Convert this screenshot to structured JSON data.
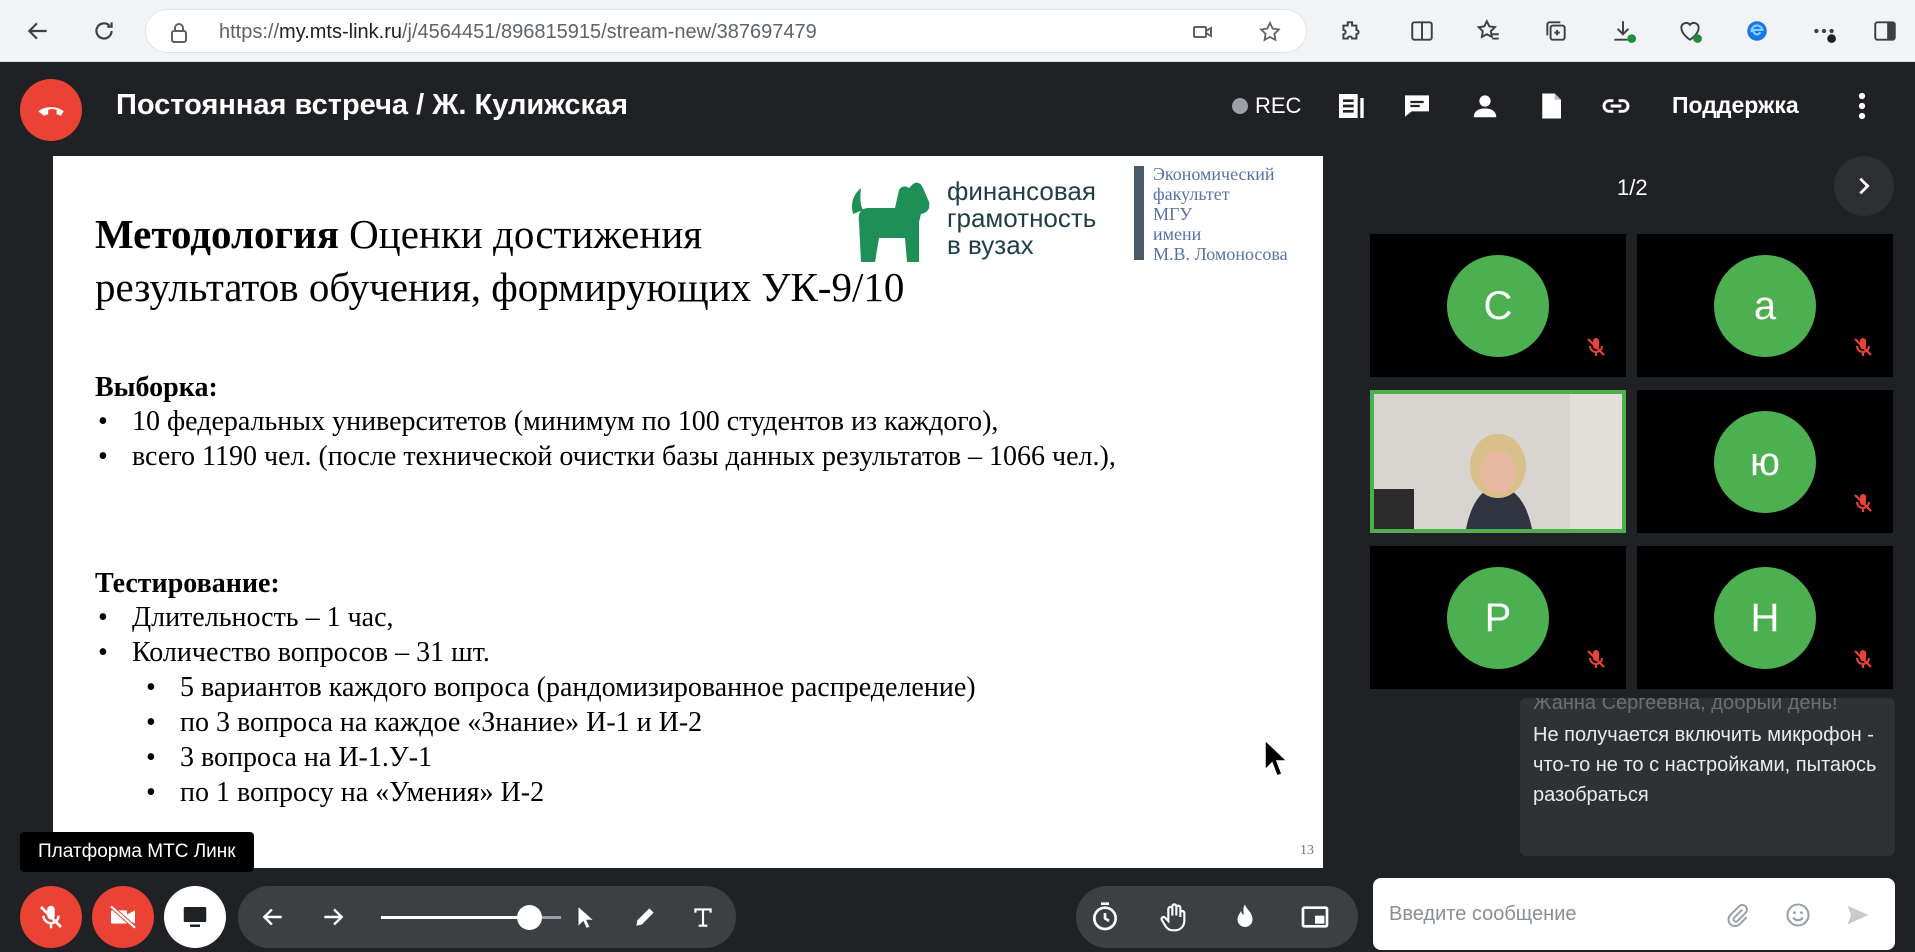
{
  "browser": {
    "url_prefix": "https://",
    "url_host": "my.mts-link.ru",
    "url_path": "/j/4564451/896815915/stream-new/387697479"
  },
  "meeting": {
    "title": "Постоянная встреча / Ж. Кулижская",
    "rec_label": "REC",
    "support_label": "Поддержка"
  },
  "slide": {
    "title_bold": "Методология",
    "title_rest": " Оценки достижения результатов обучения, формирующих УК-9/10",
    "logo_text": [
      "финансовая",
      "грамотность",
      "в вузах"
    ],
    "logo_msu": [
      "Экономический",
      "факультет",
      "МГУ",
      "имени",
      "М.В. Ломоносова"
    ],
    "section1_heading": "Выборка:",
    "section1_items": [
      "10 федеральных университетов (минимум по 100 студентов из каждого),",
      "всего 1190 чел. (после технической очистки базы данных результатов – 1066 чел.),"
    ],
    "section2_heading": "Тестирование:",
    "section2_items": [
      "Длительность – 1 час,",
      "Количество вопросов – 31 шт."
    ],
    "section2_subitems": [
      "5 вариантов каждого вопроса (рандомизированное распределение)",
      "по 3 вопроса на каждое «Знание» И-1 и И-2",
      "3 вопроса на И-1.У-1",
      "по 1 вопросу на «Умения» И-2"
    ],
    "page_number": "13",
    "bullet_char": "•"
  },
  "participants": {
    "pager": "1/2",
    "tiles": [
      {
        "initial": "С"
      },
      {
        "initial": "а"
      },
      {
        "initial": ""
      },
      {
        "initial": "ю"
      },
      {
        "initial": "Р"
      },
      {
        "initial": "Н"
      }
    ]
  },
  "chat": {
    "faded_text": "Жанна Сергеевна, добрый день!",
    "message": "Не получается включить микрофон - что-то не то с настройками, пытаюсь разобраться",
    "input_placeholder": "Введите сообщение"
  },
  "toolbar": {
    "tooltip": "Платформа МТС Линк",
    "zoom_level": 0.82
  },
  "colors": {
    "accent_green": "#4caf50",
    "danger_red": "#ea4335",
    "logo_green": "#1f8f58"
  }
}
